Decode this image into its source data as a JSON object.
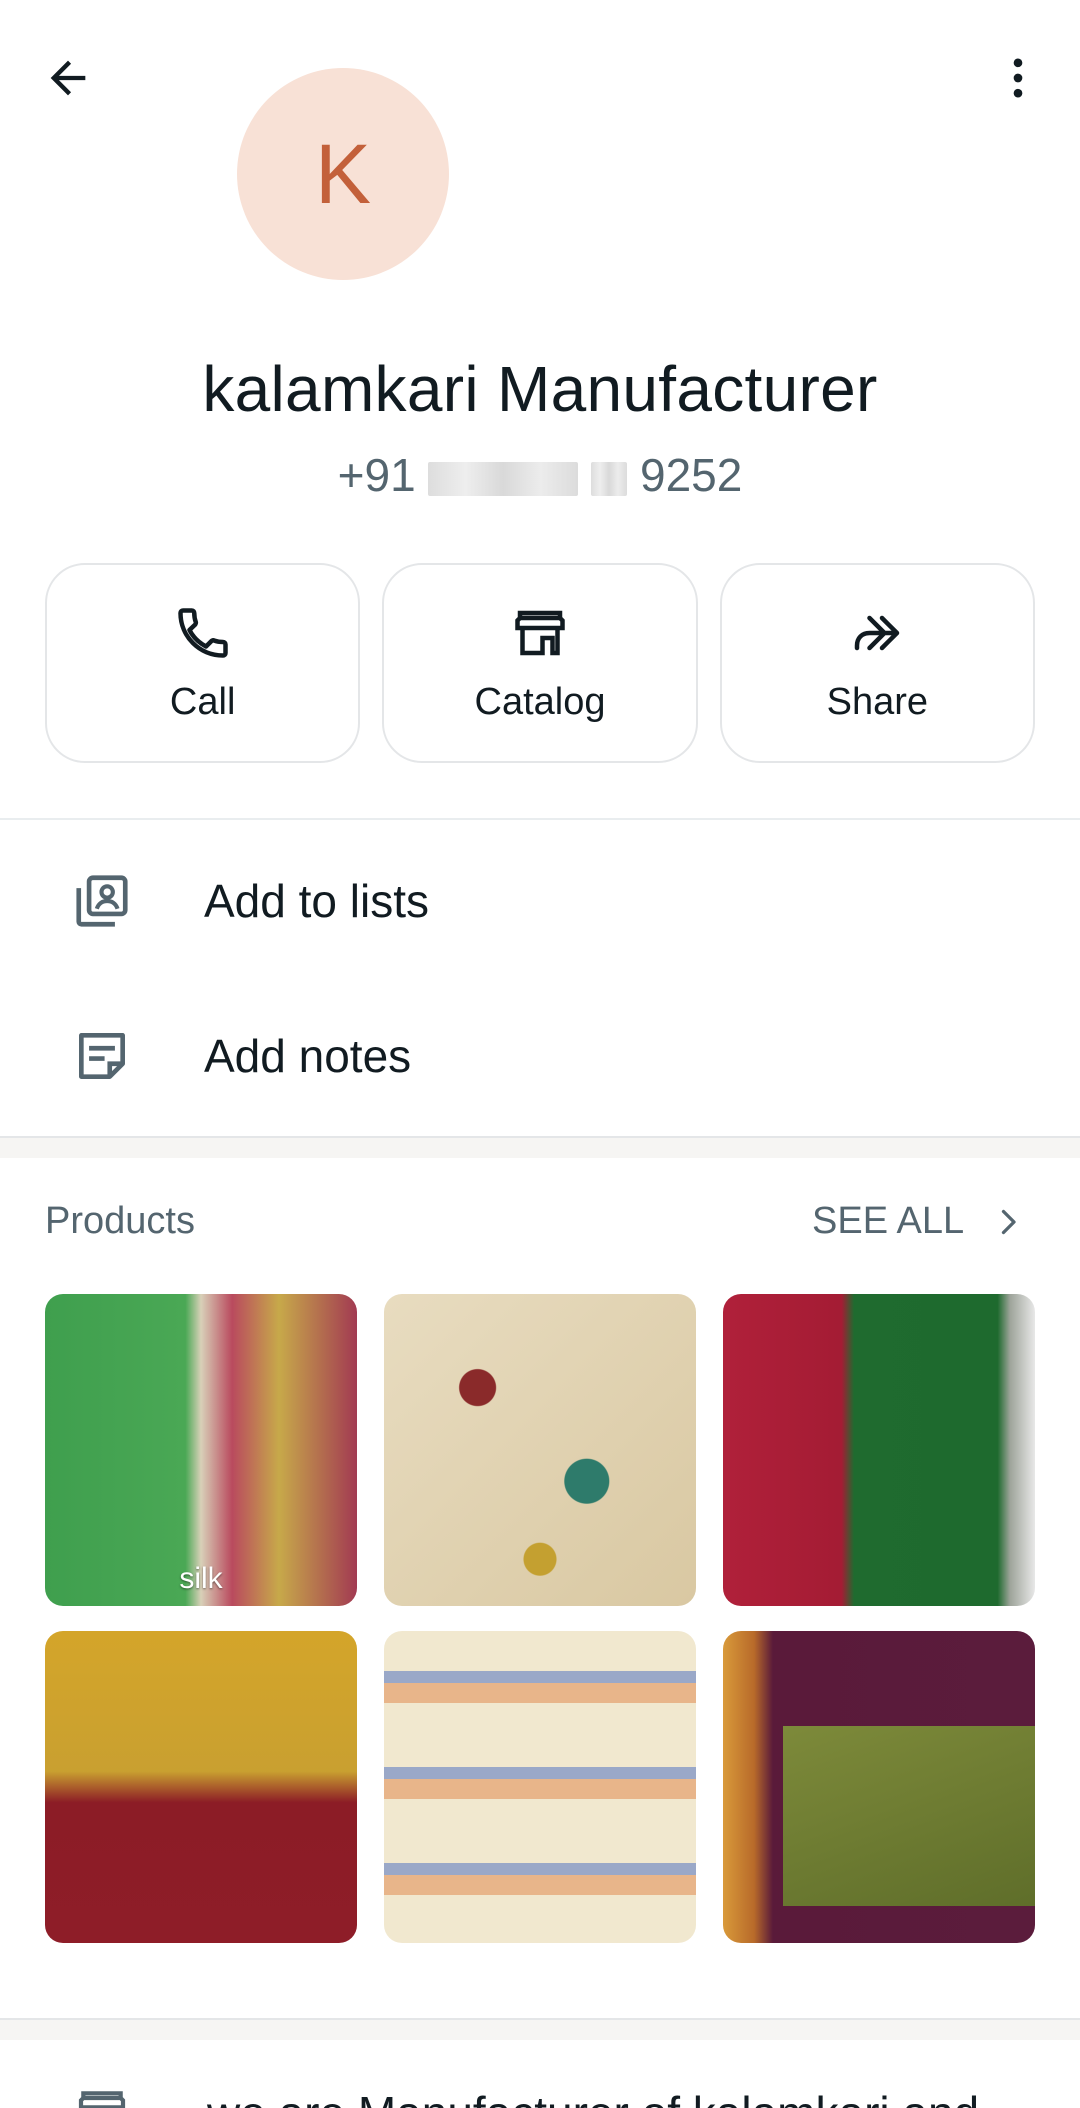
{
  "contact": {
    "avatar_letter": "K",
    "name": "kalamkari Manufacturer",
    "phone_prefix": "+91",
    "phone_suffix": "9252"
  },
  "actions": [
    {
      "label": "Call",
      "icon": "phone-icon"
    },
    {
      "label": "Catalog",
      "icon": "store-icon"
    },
    {
      "label": "Share",
      "icon": "forward-icon"
    }
  ],
  "menu": {
    "add_to_lists": "Add to lists",
    "add_notes": "Add notes"
  },
  "products": {
    "heading": "Products",
    "see_all": "SEE ALL",
    "items": [
      {
        "caption": "silk"
      },
      {
        "caption": ""
      },
      {
        "caption": ""
      },
      {
        "caption": ""
      },
      {
        "caption": ""
      },
      {
        "caption": ""
      }
    ]
  },
  "about": {
    "text": "we are Manufacturer of kalamkari and"
  },
  "colors": {
    "avatar_bg": "#f8e1d6",
    "avatar_fg": "#c3603a",
    "secondary_text": "#54656f"
  }
}
